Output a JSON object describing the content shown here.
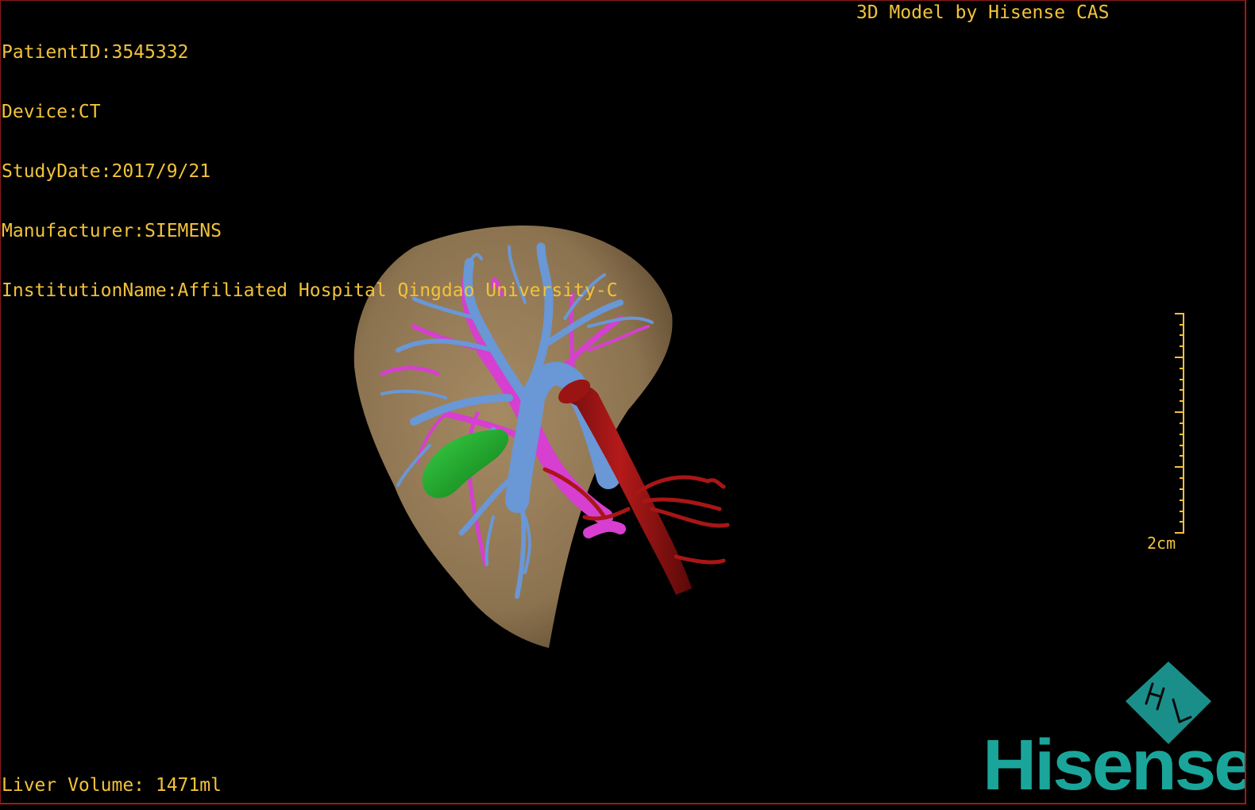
{
  "header": {
    "patient_id": "PatientID:3545332",
    "device": "Device:CT",
    "study_date": "StudyDate:2017/9/21",
    "manufacturer": "Manufacturer:SIEMENS",
    "institution": "InstitutionName:Affiliated Hospital Qingdao University-C"
  },
  "brand_title": "3D Model by Hisense CAS",
  "scale": {
    "label": "2cm"
  },
  "footer": {
    "liver_volume": "Liver Volume: 1471ml"
  },
  "logo": {
    "text": "Hisense",
    "mark_icon": "hisense-cas-diamond-logo"
  },
  "model": {
    "structures": [
      {
        "name": "liver",
        "color": "#8c7350"
      },
      {
        "name": "portal-vein",
        "color": "#6a97d6"
      },
      {
        "name": "hepatic-vein",
        "color": "#d63fd0"
      },
      {
        "name": "gallbladder",
        "color": "#1fae2a"
      },
      {
        "name": "aorta",
        "color": "#a81616"
      }
    ]
  },
  "colors": {
    "hud_text": "#f2c23a",
    "background": "#000000",
    "brand": "#1aa59a"
  }
}
